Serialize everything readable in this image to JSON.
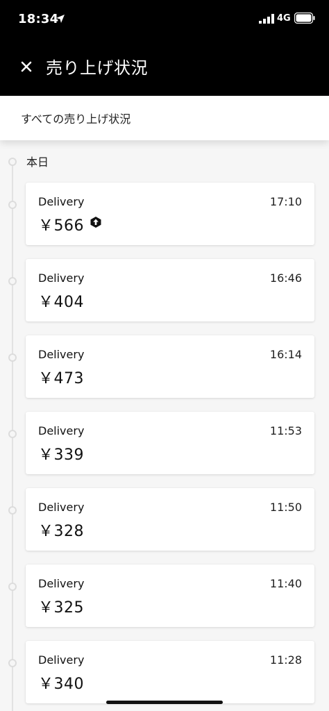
{
  "status_bar": {
    "time": "18:34",
    "network": "4G"
  },
  "header": {
    "title": "売り上げ状況",
    "close_icon": "close-icon"
  },
  "filter": {
    "label": "すべての売り上げ状況"
  },
  "section": {
    "label": "本日"
  },
  "trips": [
    {
      "type": "Delivery",
      "time": "17:10",
      "amount": "￥566",
      "boost": true
    },
    {
      "type": "Delivery",
      "time": "16:46",
      "amount": "￥404",
      "boost": false
    },
    {
      "type": "Delivery",
      "time": "16:14",
      "amount": "￥473",
      "boost": false
    },
    {
      "type": "Delivery",
      "time": "11:53",
      "amount": "￥339",
      "boost": false
    },
    {
      "type": "Delivery",
      "time": "11:50",
      "amount": "￥328",
      "boost": false
    },
    {
      "type": "Delivery",
      "time": "11:40",
      "amount": "￥325",
      "boost": false
    },
    {
      "type": "Delivery",
      "time": "11:28",
      "amount": "￥340",
      "boost": false
    }
  ],
  "colors": {
    "header_bg": "#000000",
    "page_bg": "#f6f6f6",
    "card_bg": "#ffffff"
  }
}
